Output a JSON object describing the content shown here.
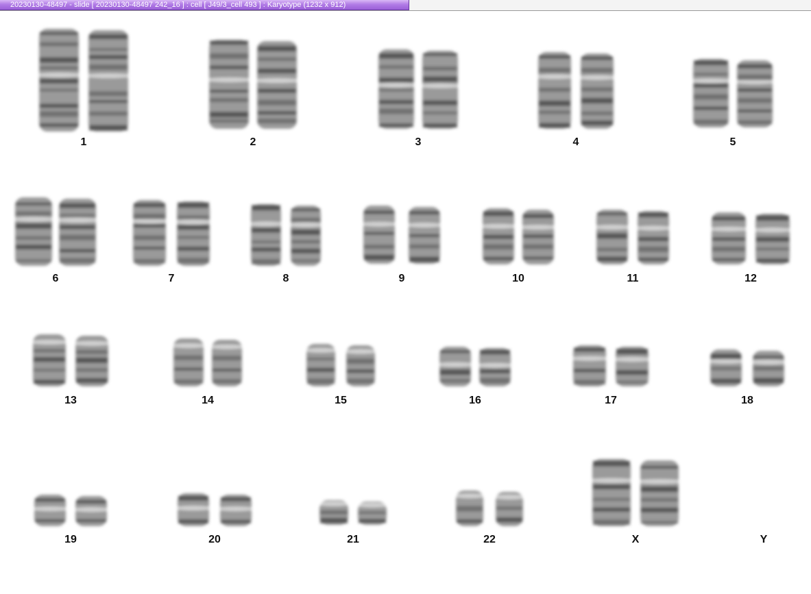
{
  "window": {
    "title": "20230130-48497 - slide [ 20230130-48497 242_16 ] : cell [ J49/3_cell 493 ] : Karyotype  (1232 x 912)"
  },
  "karyotype": {
    "labels": {
      "c1": "1",
      "c2": "2",
      "c3": "3",
      "c4": "4",
      "c5": "5",
      "c6": "6",
      "c7": "7",
      "c8": "8",
      "c9": "9",
      "c10": "10",
      "c11": "11",
      "c12": "12",
      "c13": "13",
      "c14": "14",
      "c15": "15",
      "c16": "16",
      "c17": "17",
      "c18": "18",
      "c19": "19",
      "c20": "20",
      "c21": "21",
      "c22": "22",
      "cX": "X",
      "cY": "Y"
    }
  }
}
